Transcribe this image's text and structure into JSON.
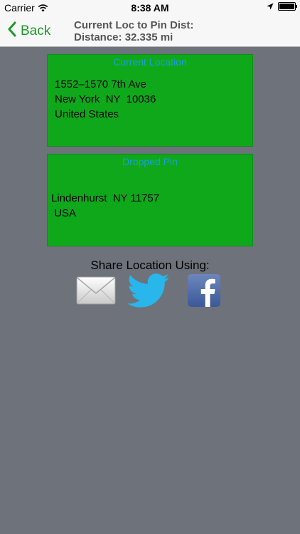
{
  "status_bar": {
    "carrier": "Carrier",
    "time": "8:38 AM"
  },
  "nav": {
    "back_label": "Back",
    "title_line1": "Current Loc to Pin Dist:",
    "title_line2": "Distance: 32.335 mi"
  },
  "current_location": {
    "title": "Current Location",
    "lines": [
      "1552–1570 7th Ave",
      "New York  NY  10036",
      "United States"
    ]
  },
  "dropped_pin": {
    "title": "Dropped Pin",
    "lines": [
      "Lindenhurst  NY 11757",
      " USA"
    ]
  },
  "share": {
    "label": "Share Location Using:",
    "options": [
      {
        "name": "email",
        "icon": "mail-icon"
      },
      {
        "name": "twitter",
        "icon": "twitter-icon"
      },
      {
        "name": "facebook",
        "icon": "facebook-icon"
      }
    ]
  },
  "colors": {
    "background": "#6e727b",
    "card_green": "#0fa81a",
    "card_title_blue": "#1aa0d8",
    "accent_green": "#1d9a2b",
    "twitter_blue": "#29b6ea",
    "facebook_blue": "#3b5998"
  }
}
